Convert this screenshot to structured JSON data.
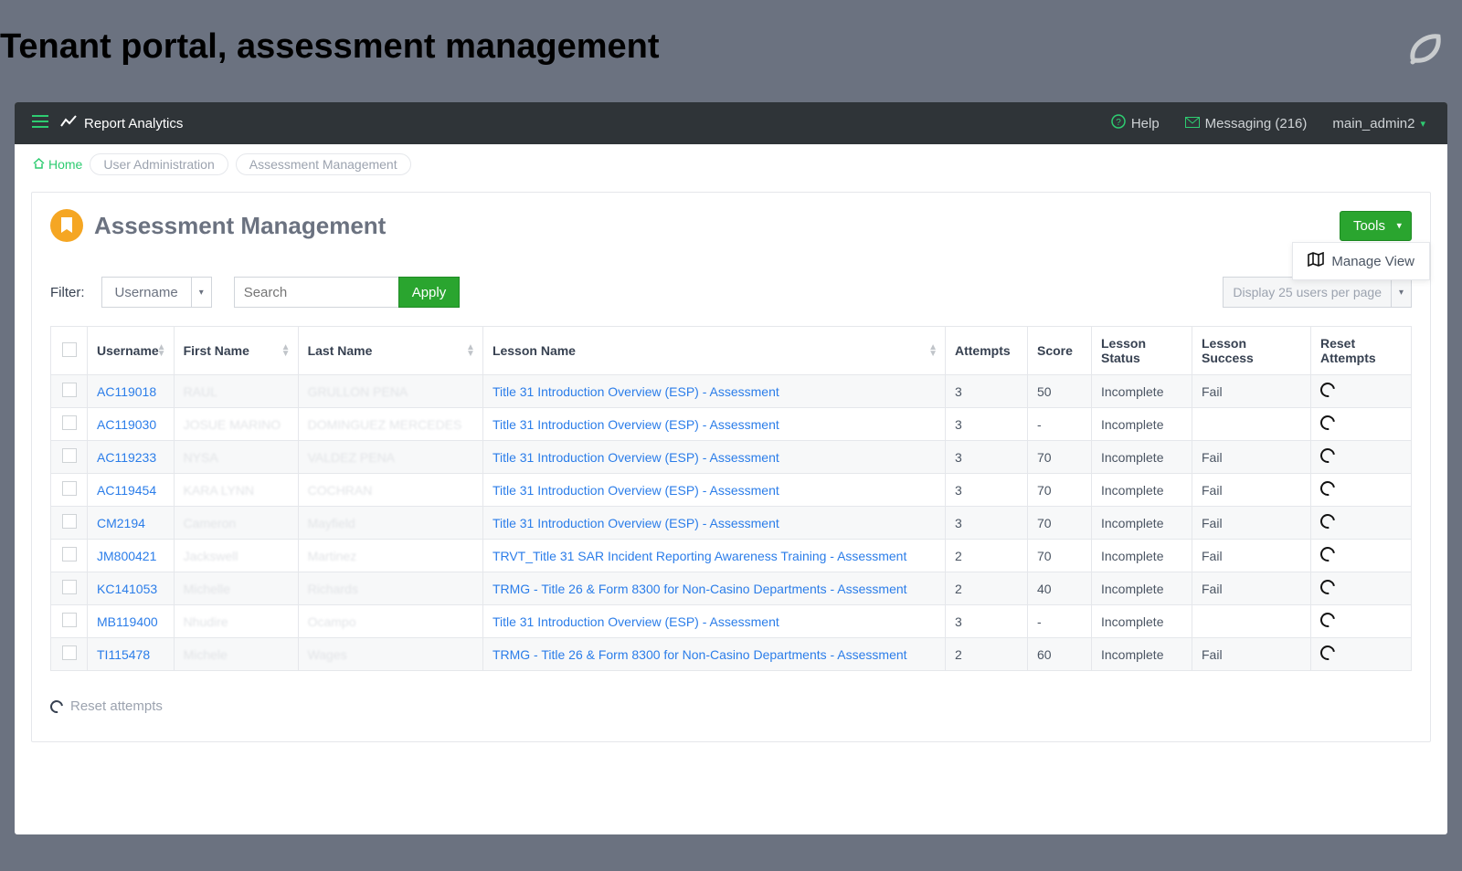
{
  "outer": {
    "heading": "Tenant portal, assessment management"
  },
  "topbar": {
    "brand": "Report Analytics",
    "help": "Help",
    "messaging": "Messaging (216)",
    "user": "main_admin2"
  },
  "breadcrumb": {
    "home": "Home",
    "b1": "User Administration",
    "b2": "Assessment Management"
  },
  "panel": {
    "title": "Assessment Management",
    "tools": "Tools",
    "manage_view": "Manage View"
  },
  "filter": {
    "label": "Filter:",
    "field": "Username",
    "search_placeholder": "Search",
    "apply": "Apply",
    "display": "Display 25 users per page"
  },
  "columns": {
    "username": "Username",
    "first_name": "First Name",
    "last_name": "Last Name",
    "lesson_name": "Lesson Name",
    "attempts": "Attempts",
    "score": "Score",
    "status": "Lesson Status",
    "success": "Lesson Success",
    "reset": "Reset Attempts"
  },
  "rows": [
    {
      "username": "AC119018",
      "first": "RAUL",
      "last": "GRULLON PENA",
      "lesson": "Title 31 Introduction Overview (ESP) - Assessment",
      "attempts": "3",
      "score": "50",
      "status": "Incomplete",
      "success": "Fail"
    },
    {
      "username": "AC119030",
      "first": "JOSUE MARINO",
      "last": "DOMINGUEZ MERCEDES",
      "lesson": "Title 31 Introduction Overview (ESP) - Assessment",
      "attempts": "3",
      "score": "-",
      "status": "Incomplete",
      "success": ""
    },
    {
      "username": "AC119233",
      "first": "NYSA",
      "last": "VALDEZ PENA",
      "lesson": "Title 31 Introduction Overview (ESP) - Assessment",
      "attempts": "3",
      "score": "70",
      "status": "Incomplete",
      "success": "Fail"
    },
    {
      "username": "AC119454",
      "first": "KARA LYNN",
      "last": "COCHRAN",
      "lesson": "Title 31 Introduction Overview (ESP) - Assessment",
      "attempts": "3",
      "score": "70",
      "status": "Incomplete",
      "success": "Fail"
    },
    {
      "username": "CM2194",
      "first": "Cameron",
      "last": "Mayfield",
      "lesson": "Title 31 Introduction Overview (ESP) - Assessment",
      "attempts": "3",
      "score": "70",
      "status": "Incomplete",
      "success": "Fail"
    },
    {
      "username": "JM800421",
      "first": "Jackswell",
      "last": "Martinez",
      "lesson": "TRVT_Title 31 SAR Incident Reporting Awareness Training - Assessment",
      "attempts": "2",
      "score": "70",
      "status": "Incomplete",
      "success": "Fail"
    },
    {
      "username": "KC141053",
      "first": "Michelle",
      "last": "Richards",
      "lesson": "TRMG - Title 26 & Form 8300 for Non-Casino Departments - Assessment",
      "attempts": "2",
      "score": "40",
      "status": "Incomplete",
      "success": "Fail"
    },
    {
      "username": "MB119400",
      "first": "Nhudire",
      "last": "Ocampo",
      "lesson": "Title 31 Introduction Overview (ESP) - Assessment",
      "attempts": "3",
      "score": "-",
      "status": "Incomplete",
      "success": ""
    },
    {
      "username": "TI115478",
      "first": "Michele",
      "last": "Wages",
      "lesson": "TRMG - Title 26 & Form 8300 for Non-Casino Departments - Assessment",
      "attempts": "2",
      "score": "60",
      "status": "Incomplete",
      "success": "Fail"
    }
  ],
  "legend": {
    "reset": "Reset attempts"
  }
}
